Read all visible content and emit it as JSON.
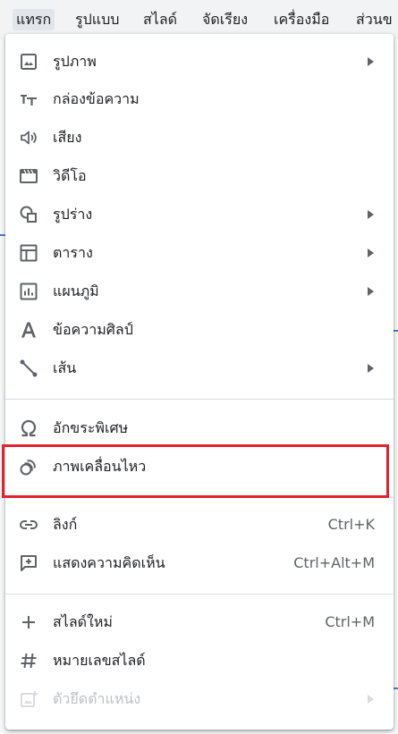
{
  "menubar": {
    "items": [
      "แทรก",
      "รูปแบบ",
      "สไลด์",
      "จัดเรียง",
      "เครื่องมือ",
      "ส่วนข"
    ]
  },
  "menu": {
    "items": [
      {
        "label": "รูปภาพ",
        "icon": "image-icon",
        "submenu": true
      },
      {
        "label": "กล่องข้อความ",
        "icon": "text-box-icon"
      },
      {
        "label": "เสียง",
        "icon": "audio-icon"
      },
      {
        "label": "วิดีโอ",
        "icon": "video-icon"
      },
      {
        "label": "รูปร่าง",
        "icon": "shapes-icon",
        "submenu": true
      },
      {
        "label": "ตาราง",
        "icon": "table-icon",
        "submenu": true
      },
      {
        "label": "แผนภูมิ",
        "icon": "chart-icon",
        "submenu": true
      },
      {
        "label": "ข้อความศิลป์",
        "icon": "word-art-icon"
      },
      {
        "label": "เส้น",
        "icon": "line-icon",
        "submenu": true
      },
      {
        "label": "อักขระพิเศษ",
        "icon": "omega-icon"
      },
      {
        "label": "ภาพเคลื่อนไหว",
        "icon": "animation-icon"
      },
      {
        "label": "ลิงก์",
        "icon": "link-icon",
        "shortcut": "Ctrl+K"
      },
      {
        "label": "แสดงความคิดเห็น",
        "icon": "comment-icon",
        "shortcut": "Ctrl+Alt+M"
      },
      {
        "label": "สไลด์ใหม่",
        "icon": "plus-icon",
        "shortcut": "Ctrl+M"
      },
      {
        "label": "หมายเลขสไลด์",
        "icon": "hash-icon"
      },
      {
        "label": "ตัวยึดตำแหน่ง",
        "icon": "placeholder-icon",
        "submenu": true,
        "disabled": true
      }
    ]
  },
  "colors": {
    "highlight": "#e3212b",
    "icon": "#5f6368",
    "separator": "#dadce0"
  }
}
